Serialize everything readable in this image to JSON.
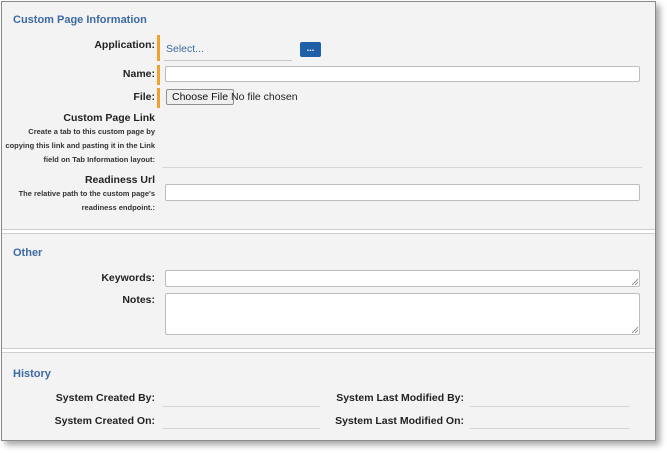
{
  "custom_page": {
    "title": "Custom Page Information",
    "application_label": "Application:",
    "application_value": "Select...",
    "browse_label": "...",
    "name_label": "Name:",
    "file_label": "File:",
    "choose_file_label": "Choose File",
    "no_file_text": "No file chosen",
    "custom_page_link_label": "Custom Page Link",
    "custom_page_link_help_1": "Create a tab to this custom page by",
    "custom_page_link_help_2": "copying this link and pasting it in the Link",
    "custom_page_link_help_3": "field on Tab Information layout:",
    "readiness_url_label": "Readiness Url",
    "readiness_url_help_1": "The relative path to the custom page's",
    "readiness_url_help_2": "readiness endpoint.:"
  },
  "other": {
    "title": "Other",
    "keywords_label": "Keywords:",
    "notes_label": "Notes:"
  },
  "history": {
    "title": "History",
    "created_by_label": "System Created By:",
    "created_on_label": "System Created On:",
    "modified_by_label": "System Last Modified By:",
    "modified_on_label": "System Last Modified On:"
  },
  "colors": {
    "section_title": "#3d6aa3",
    "required_marker": "#f0a030",
    "button": "#1f5fa8"
  }
}
